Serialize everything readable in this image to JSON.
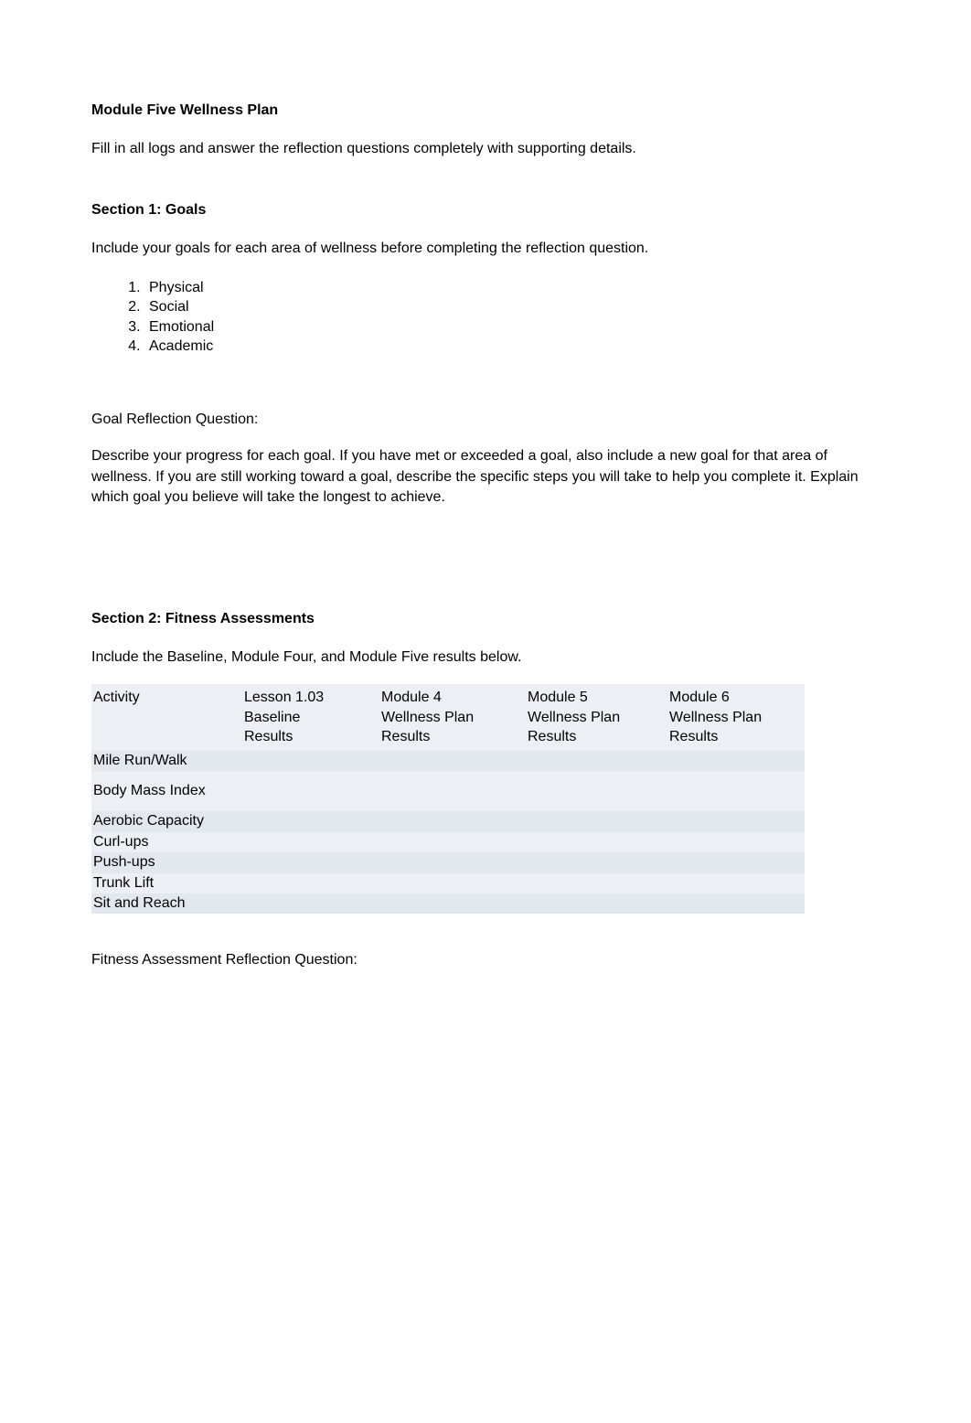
{
  "title": "Module Five Wellness Plan",
  "intro": "Fill in all logs and answer the reflection questions completely with supporting details.",
  "section1": {
    "heading": "Section 1: Goals",
    "instruction": "Include your goals for each area of wellness before completing the reflection question.",
    "list": [
      "Physical",
      "Social",
      "Emotional",
      "Academic"
    ],
    "reflection_label": "Goal Reflection Question:",
    "reflection_text": "Describe your progress for each goal.  If you have met or exceeded a goal, also include a new goal for that area of wellness.  If you are still working toward a goal, describe the specific steps you will take to help you complete it.  Explain which goal you believe will take the longest to achieve."
  },
  "section2": {
    "heading": "Section 2: Fitness Assessments",
    "instruction": "Include the Baseline, Module Four, and Module Five results below.",
    "headers": {
      "activity": "Activity",
      "baseline_l1": "Lesson 1.03",
      "baseline_l2": "Baseline",
      "baseline_l3": "Results",
      "m4_l1": "Module 4",
      "m4_l2": "Wellness Plan",
      "m4_l3": "Results",
      "m5_l1": "Module 5",
      "m5_l2": "Wellness Plan",
      "m5_l3": "Results",
      "m6_l1": "Module 6",
      "m6_l2": "Wellness Plan",
      "m6_l3": "Results"
    },
    "rows": [
      {
        "activity": "Mile Run/Walk",
        "baseline": "",
        "m4": "",
        "m5": "",
        "m6": ""
      },
      {
        "activity": "Body Mass Index",
        "baseline": "",
        "m4": "",
        "m5": "",
        "m6": ""
      },
      {
        "activity": "Aerobic Capacity",
        "baseline": "",
        "m4": "",
        "m5": "",
        "m6": ""
      },
      {
        "activity": "Curl-ups",
        "baseline": "",
        "m4": "",
        "m5": "",
        "m6": ""
      },
      {
        "activity": "Push-ups",
        "baseline": "",
        "m4": "",
        "m5": "",
        "m6": ""
      },
      {
        "activity": "Trunk Lift",
        "baseline": "",
        "m4": "",
        "m5": "",
        "m6": ""
      },
      {
        "activity": "Sit and Reach",
        "baseline": "",
        "m4": "",
        "m5": "",
        "m6": ""
      }
    ],
    "reflection_label": "Fitness Assessment Reflection Question:"
  }
}
